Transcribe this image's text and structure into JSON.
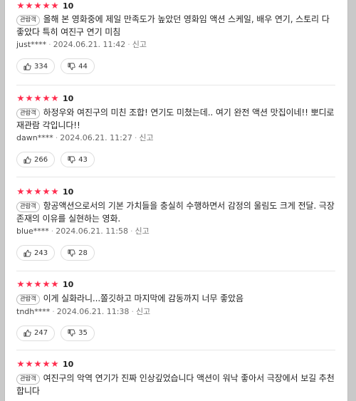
{
  "reviews": [
    {
      "stars": 5,
      "score": "10",
      "badge": "관람객",
      "text": "올해 본 영화중에 제일 만족도가 높았던 영화임 액션 스케일, 배우 연기, 스토리 다 좋았다 특히 여진구 연기 미침",
      "author": "just****",
      "date": "2024.06.21. 11:42",
      "report": "신고",
      "likes": "334",
      "dislikes": "44"
    },
    {
      "stars": 5,
      "score": "10",
      "badge": "관람객",
      "text": "하정우와 여진구의 미친 조합! 연기도 미쳤는데.. 여기 완전 액션 맛집이네!! 뽀디로 재관람 각입니다!!",
      "author": "dawn****",
      "date": "2024.06.21. 11:27",
      "report": "신고",
      "likes": "266",
      "dislikes": "43"
    },
    {
      "stars": 5,
      "score": "10",
      "badge": "관람객",
      "text": "항공액션으로서의 기본 가치들을 충실히 수행하면서 감정의 울림도 크게 전달. 극장 존재의 이유를 실현하는 영화.",
      "author": "blue****",
      "date": "2024.06.21. 11:58",
      "report": "신고",
      "likes": "243",
      "dislikes": "28"
    },
    {
      "stars": 5,
      "score": "10",
      "badge": "관람객",
      "text": "이게 실화라니...쫄깃하고 마지막에 감동까지 너무 좋았음",
      "author": "tndh****",
      "date": "2024.06.21. 11:38",
      "report": "신고",
      "likes": "247",
      "dislikes": "35"
    },
    {
      "stars": 5,
      "score": "10",
      "badge": "관람객",
      "text": "여진구의 악역 연기가 진짜 인상깊었습니다 액션이 워낙 좋아서 극장에서 보길 추천합니다",
      "author": "",
      "date": "",
      "report": "",
      "likes": "",
      "dislikes": ""
    }
  ],
  "icons": {
    "star": "star-icon",
    "like": "thumbs-up-icon",
    "dislike": "thumbs-down-icon"
  },
  "colors": {
    "star": "#ff2e4f",
    "divider": "#e7e7e7"
  }
}
